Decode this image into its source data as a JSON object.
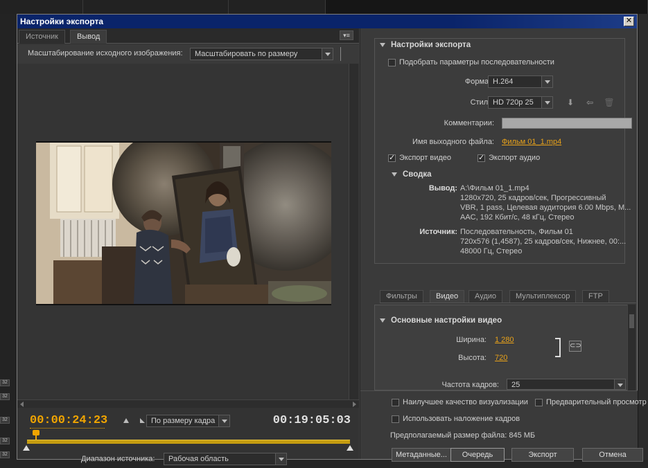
{
  "window": {
    "title": "Настройки экспорта",
    "close_label": "✕"
  },
  "left": {
    "tabs": [
      "Источник",
      "Вывод"
    ],
    "tab_menu_icon": "▾≡",
    "scale_label": "Масштабирование исходного изображения:",
    "scale_value": "Масштабировать по размеру",
    "current_time": "00:00:24:23",
    "fit_value": "По размеру кадра",
    "duration": "00:19:05:03",
    "source_range_label": "Диапазон источника:",
    "source_range_value": "Рабочая область"
  },
  "export_settings": {
    "title": "Настройки экспорта",
    "match_sequence": "Подобрать параметры последовательности",
    "format_label": "Формат:",
    "format_value": "H.264",
    "preset_label": "Стиль:",
    "preset_value": "HD 720p 25",
    "comments_label": "Комментарии:",
    "output_name_label": "Имя выходного файла:",
    "output_name": "Фильм 01_1.mp4",
    "export_video": "Экспорт видео",
    "export_audio": "Экспорт аудио",
    "summary_title": "Сводка",
    "output_label": "Вывод:",
    "output_lines": [
      "A:\\Фильм 01_1.mp4",
      "1280x720, 25 кадров/сек, Прогрессивный",
      "VBR, 1 pass, Целевая аудитория 6.00 Mbps, M...",
      "AAC, 192 Кбит/с, 48 кГц, Стерео"
    ],
    "source_label": "Источник:",
    "source_lines": [
      "Последовательность, Фильм 01",
      "720x576 (1,4587), 25 кадров/сек, Нижнее, 00:...",
      "48000 Гц, Стерео"
    ]
  },
  "subtabs": [
    "Фильтры",
    "Видео",
    "Аудио",
    "Мультиплексор",
    "FTP"
  ],
  "video_settings": {
    "title": "Основные настройки видео",
    "width_label": "Ширина:",
    "width_value": "1 280",
    "height_label": "Высота:",
    "height_value": "720",
    "framerate_label": "Частота кадров:",
    "framerate_value": "25"
  },
  "bottom": {
    "max_render_quality": "Наилучшее качество визуализации",
    "preview": "Предварительный просмотр",
    "use_blending": "Использовать наложение кадров",
    "file_size": "Предполагаемый размер файла:  845 МБ"
  },
  "buttons": {
    "metadata": "Метаданные...",
    "queue": "Очередь",
    "export": "Экспорт",
    "cancel": "Отмена"
  },
  "background": {
    "left_markers": [
      "32",
      "32",
      "32",
      "32",
      "32"
    ]
  }
}
